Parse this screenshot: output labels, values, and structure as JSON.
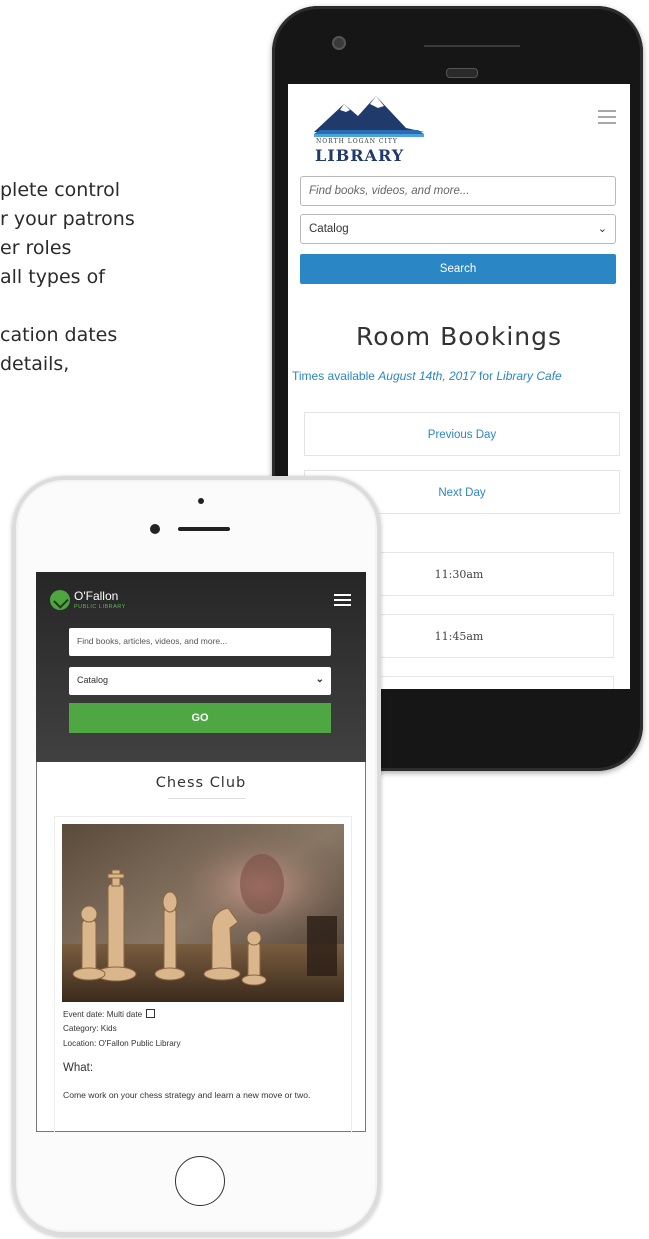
{
  "background_text": {
    "lines": [
      "plete control",
      "r your patrons",
      "er roles",
      "all types of",
      "",
      "cation dates",
      "details,"
    ]
  },
  "north_logan": {
    "logo_small": "NORTH LOGAN CITY",
    "logo_big": "LIBRARY",
    "menu_icon": "hamburger-icon",
    "search_placeholder": "Find books, videos, and more...",
    "catalog_select": "Catalog",
    "search_button": "Search",
    "heading": "Room Bookings",
    "subheading": {
      "prefix": "Times available ",
      "date": "August 14th, 2017",
      "middle": " for ",
      "place": "Library Cafe"
    },
    "previous_day": "Previous Day",
    "next_day": "Next Day",
    "time_slots": [
      "11:30am",
      "11:45am"
    ],
    "accent_color": "#2b86c6"
  },
  "ofallon": {
    "logo_name": "O'Fallon",
    "logo_sub": "PUBLIC LIBRARY",
    "menu_icon": "hamburger-icon",
    "search_placeholder": "Find books, articles, videos, and more...",
    "catalog_select": "Catalog",
    "go_button": "GO",
    "event_title": "Chess Club",
    "event_date": "Event date: Multi date",
    "calendar_icon": "calendar-icon",
    "category": "Category: Kids",
    "location": "Location: O'Fallon Public Library",
    "what_heading": "What:",
    "description": "Come work on your chess strategy and learn a new move or two.",
    "accent_color": "#4fa743"
  }
}
